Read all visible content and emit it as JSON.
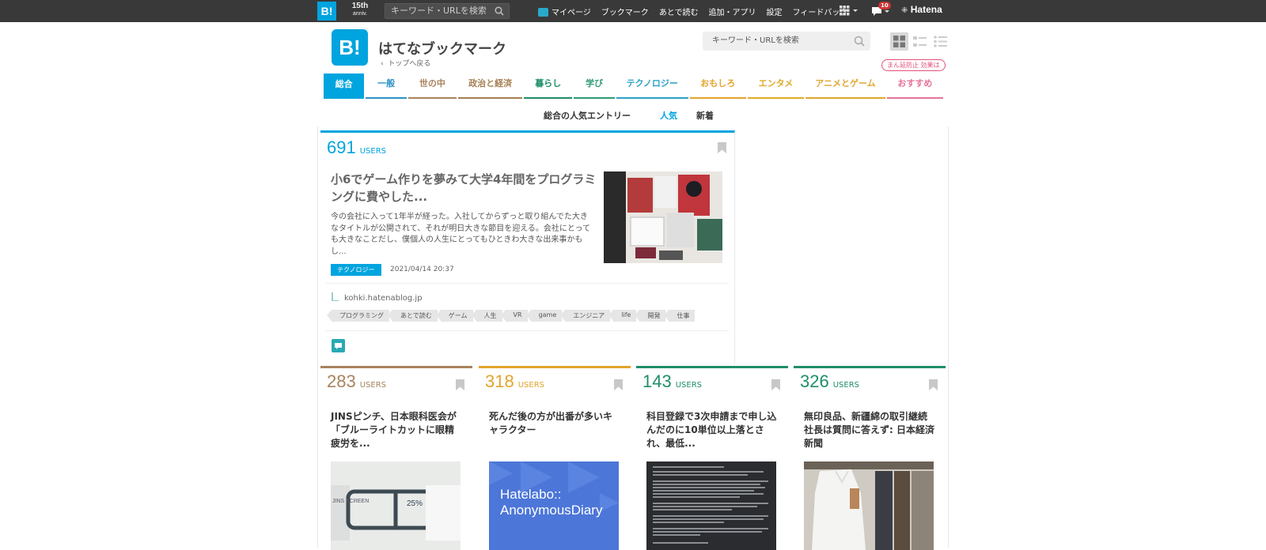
{
  "global_bar": {
    "logo": "B!",
    "anniv_top": "15th",
    "anniv_bottom": "anniv.",
    "search_placeholder": "キーワード・URLを検索",
    "nav": [
      "マイページ",
      "ブックマーク",
      "あとで読む",
      "追加・アプリ",
      "設定",
      "フィードバック"
    ],
    "notification_count": "10",
    "brand": "Hatena"
  },
  "header": {
    "logo": "B!",
    "title": "はてなブックマーク",
    "back_link": "トップへ戻る",
    "search_placeholder": "キーワード・URLを検索",
    "promo": "まん延防止 効果は"
  },
  "categories": [
    {
      "label": "総合",
      "color": "#00a4de",
      "active": true
    },
    {
      "label": "一般",
      "color": "#2b92c4"
    },
    {
      "label": "世の中",
      "color": "#a8835e"
    },
    {
      "label": "政治と経済",
      "color": "#a67f53"
    },
    {
      "label": "暮らし",
      "color": "#1f8e6a"
    },
    {
      "label": "学び",
      "color": "#2f9a77"
    },
    {
      "label": "テクノロジー",
      "color": "#2aa2c8"
    },
    {
      "label": "おもしろ",
      "color": "#e3a42c"
    },
    {
      "label": "エンタメ",
      "color": "#e0ab2e"
    },
    {
      "label": "アニメとゲーム",
      "color": "#e0a72f"
    },
    {
      "label": "おすすめ",
      "color": "#e7739a"
    }
  ],
  "subnav": {
    "title": "総合の人気エントリー",
    "popular": "人気",
    "new": "新着"
  },
  "main_entry": {
    "users": "691",
    "users_label": "USERS",
    "color": "#00a4de",
    "title": "小6でゲーム作りを夢みて大学4年間をプログラミングに費やした...",
    "summary": "今の会社に入って1年半が経った。入社してからずっと取り組んでた大きなタイトルが公開されて、それが明日大きな節目を迎える。会社にとっても大きなことだし、僕個人の人生にとってもひときわ大きな出来事かもし...",
    "category": "テクノロジー",
    "date": "2021/04/14 20:37",
    "site": "kohki.hatenablog.jp",
    "tags": [
      "プログラミング",
      "あとで読む",
      "ゲーム",
      "人生",
      "VR",
      "game",
      "エンジニア",
      "life",
      "開発",
      "仕事"
    ]
  },
  "small_entries": [
    {
      "users": "283",
      "users_label": "USERS",
      "color": "#a8835e",
      "title": "JINSピンチ、日本眼科医会が「ブルーライトカットに眼精疲労を...",
      "thumb_text": "25%",
      "thumb_side": "JINS SCREEN"
    },
    {
      "users": "318",
      "users_label": "USERS",
      "color": "#e3a42c",
      "title": "死んだ後の方が出番が多いキャラクター",
      "thumb_text": "Hatelabo:: AnonymousDiary"
    },
    {
      "users": "143",
      "users_label": "USERS",
      "color": "#1f8e6a",
      "title": "科目登録で3次申請まで申し込んだのに10単位以上落とされ、最低..."
    },
    {
      "users": "326",
      "users_label": "USERS",
      "color": "#1f8e6a",
      "title": "無印良品、新疆綿の取引継続 社長は質問に答えず: 日本経済新聞"
    }
  ]
}
